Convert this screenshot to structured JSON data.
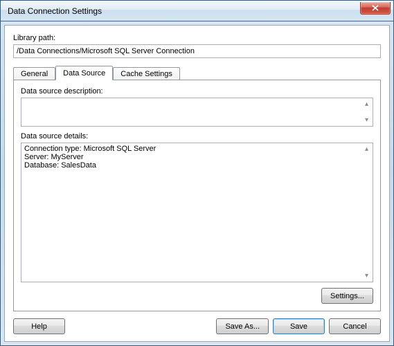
{
  "window": {
    "title": "Data Connection Settings"
  },
  "library": {
    "label": "Library path:",
    "value": "/Data Connections/Microsoft SQL Server Connection"
  },
  "tabs": {
    "general": "General",
    "data_source": "Data Source",
    "cache_settings": "Cache Settings",
    "active": "data_source"
  },
  "panel": {
    "desc_label": "Data source description:",
    "desc_value": "",
    "details_label": "Data source details:",
    "details_value": "Connection type: Microsoft SQL Server\nServer: MyServer\nDatabase: SalesData",
    "settings_button": "Settings..."
  },
  "buttons": {
    "help": "Help",
    "save_as": "Save As...",
    "save": "Save",
    "cancel": "Cancel"
  }
}
